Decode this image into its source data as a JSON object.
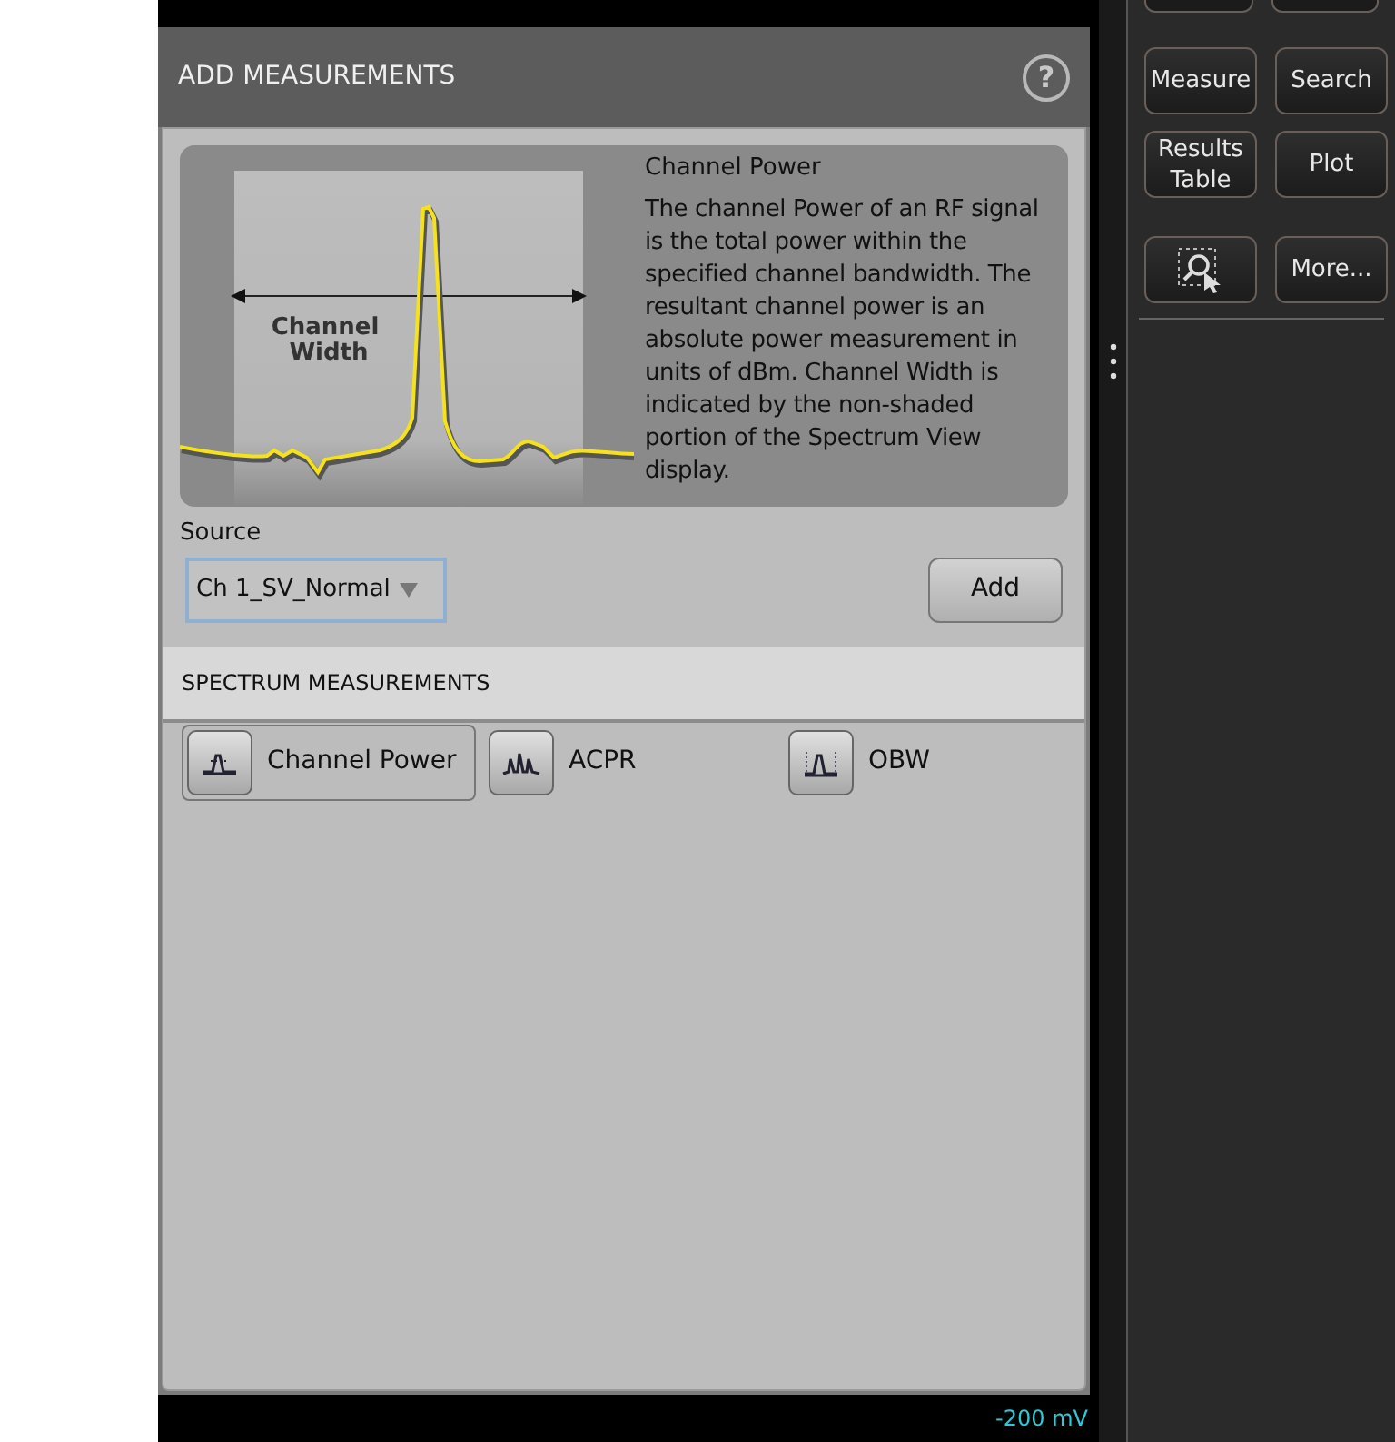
{
  "dialog": {
    "title": "ADD MEASUREMENTS",
    "help_icon": "?"
  },
  "info": {
    "diagram_label": [
      "Channel",
      "Width"
    ],
    "title": "Channel Power",
    "description": "The channel Power of an RF signal is the total power within the specified channel bandwidth. The resultant channel power is an absolute power measurement in units of dBm. Channel Width is indicated by the non-shaded portion of the Spectrum View display."
  },
  "source": {
    "label": "Source",
    "value": "Ch 1_SV_Normal"
  },
  "add_button": "Add",
  "section": {
    "title": "SPECTRUM MEASUREMENTS"
  },
  "measurements": [
    {
      "label": "Channel Power",
      "kind": "channel",
      "selected": true
    },
    {
      "label": "ACPR",
      "kind": "acpr",
      "selected": false
    },
    {
      "label": "OBW",
      "kind": "obw",
      "selected": false
    }
  ],
  "scope": {
    "scale_label": "-200 mV"
  },
  "side_buttons": [
    {
      "label": "Measure",
      "kind": "text"
    },
    {
      "label": "Search",
      "kind": "text"
    },
    {
      "label": "Results Table",
      "kind": "text"
    },
    {
      "label": "Plot",
      "kind": "text"
    },
    {
      "kind": "zoom"
    },
    {
      "label": "More...",
      "kind": "text"
    }
  ]
}
